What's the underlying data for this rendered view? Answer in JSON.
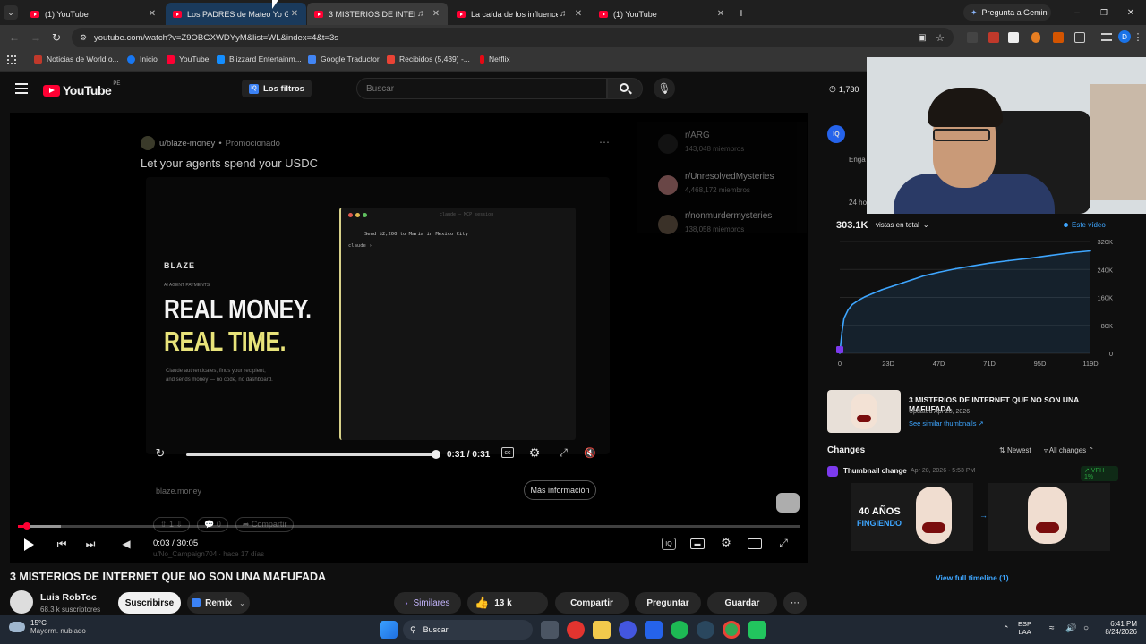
{
  "browser": {
    "tabs": [
      {
        "title": "(1) YouTube"
      },
      {
        "title": "Los PADRES de Mateo Yo Guap"
      },
      {
        "title": "3 MISTERIOS DE INTERNET"
      },
      {
        "title": "La caída de los influencers."
      },
      {
        "title": "(1) YouTube"
      }
    ],
    "gemini_label": "Pregunta a Gemini",
    "url": "youtube.com/watch?v=Z9OBGXWDYyM&list=WL&index=4&t=3s",
    "bookmarks": [
      {
        "label": "Noticias de World o..."
      },
      {
        "label": "Inicio"
      },
      {
        "label": "YouTube"
      },
      {
        "label": "Blizzard Entertainm..."
      },
      {
        "label": "Google Traductor"
      },
      {
        "label": "Recibidos (5,439) -..."
      },
      {
        "label": "Netflix"
      }
    ]
  },
  "yt_header": {
    "logo_text": "YouTube",
    "region": "PE",
    "filters_label": "Los filtros",
    "search_placeholder": "Buscar",
    "counter": "1,730"
  },
  "ad": {
    "handle": "u/blaze-money",
    "promoted": "Promocionado",
    "headline": "Let your agents spend your USDC",
    "brand": "BLAZE",
    "small_caption": "AI AGENT PAYMENTS",
    "big_line1": "REAL MONEY.",
    "big_line2": "REAL TIME.",
    "body_line1": "Claude authenticates, finds your recipient,",
    "body_line2": "and sends money — no code, no dashboard.",
    "terminal_title": "claude — MCP session",
    "terminal_line1": "Send $2,200 to Maria in Mexico City",
    "terminal_line2": "claude ›",
    "inner_time": "0:31 / 0:31",
    "domain": "blaze.money",
    "more_info": "Más información",
    "votes": "1",
    "comments": "0",
    "share": "Compartir",
    "commenter": "u/No_Campaign704",
    "comment_time": "hace 17 días",
    "subs": [
      {
        "name": "r/ARG",
        "members": "143,048 miembros"
      },
      {
        "name": "r/UnresolvedMysteries",
        "members": "4,468,172 miembros"
      },
      {
        "name": "r/nonmurdermysteries",
        "members": "138,058 miembros"
      }
    ]
  },
  "player": {
    "time": "0:03 / 30:05",
    "progress": 0.0017
  },
  "video": {
    "title": "3 MISTERIOS DE INTERNET QUE NO SON UNA MAFUFADA",
    "channel": "Luis RobToc",
    "subscribers": "68.3 k suscriptores",
    "subscribe": "Suscribirse",
    "remix": "Remix",
    "similar": "Similares",
    "likes": "13 k",
    "share": "Compartir",
    "ask": "Preguntar",
    "save": "Guardar"
  },
  "side": {
    "eng_label": "Enga",
    "hours_label": "24 ho",
    "views_total": "303.1K",
    "views_selector": "vistas en total",
    "legend": "Este vídeo",
    "thumb_title": "3 MISTERIOS DE INTERNET QUE NO SON UNA MAFUFADA",
    "updated": "Updated Apr 28, 2026",
    "similar_thumbs": "See similar thumbnails ↗",
    "changes": "Changes",
    "newest": "Newest",
    "all_changes": "All changes",
    "change_type": "Thumbnail change",
    "change_date": "Apr 28, 2026 · 5:53 PM",
    "vph": "↗ VPH 1%",
    "old_thumb_line1": "40 AÑOS",
    "old_thumb_line2": "FINGIENDO",
    "timeline_link": "View full timeline (1)"
  },
  "chart_data": {
    "type": "line",
    "title": "",
    "xlabel": "",
    "ylabel": "",
    "x_tick_labels": [
      "0",
      "23D",
      "47D",
      "71D",
      "95D",
      "119D"
    ],
    "y_tick_labels": [
      "0",
      "80K",
      "160K",
      "240K",
      "320K"
    ],
    "xlim": [
      0,
      119
    ],
    "ylim": [
      0,
      320000
    ],
    "series": [
      {
        "name": "Este vídeo",
        "x": [
          0,
          1,
          2,
          4,
          6,
          9,
          12,
          16,
          20,
          25,
          30,
          35,
          40,
          47,
          55,
          63,
          71,
          80,
          90,
          100,
          110,
          119
        ],
        "y": [
          0,
          60000,
          100000,
          125000,
          140000,
          152000,
          162000,
          172000,
          182000,
          192000,
          202000,
          212000,
          222000,
          232000,
          242000,
          250000,
          258000,
          265000,
          272000,
          280000,
          288000,
          293000
        ]
      }
    ],
    "grid": true,
    "legend": "top-right",
    "color": "#3ea6ff"
  },
  "taskbar": {
    "weather_temp": "15°C",
    "weather_desc": "Mayorm. nublado",
    "search": "Buscar",
    "lang1": "ESP",
    "lang2": "LAA",
    "clock": "6:41 PM",
    "date": "8/24/2026"
  },
  "colors": {
    "accent": "#3ea6ff",
    "yt_red": "#ff0033",
    "vph_green": "#2ba640"
  }
}
